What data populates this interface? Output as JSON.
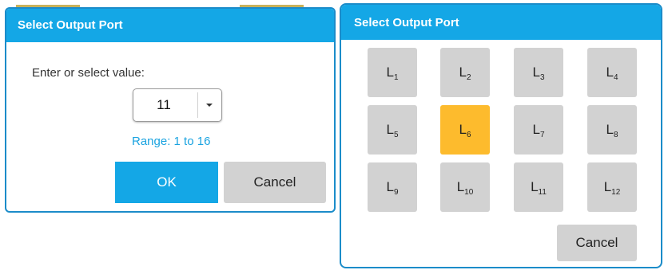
{
  "left_dialog": {
    "title": "Select Output Port",
    "prompt": "Enter or select value:",
    "combo_value": "11",
    "range": "Range: 1 to 16",
    "ok_label": "OK",
    "cancel_label": "Cancel"
  },
  "right_dialog": {
    "title": "Select Output Port",
    "ports": [
      {
        "label": "L",
        "sub": "1"
      },
      {
        "label": "L",
        "sub": "2"
      },
      {
        "label": "L",
        "sub": "3"
      },
      {
        "label": "L",
        "sub": "4"
      },
      {
        "label": "L",
        "sub": "5"
      },
      {
        "label": "L",
        "sub": "6",
        "selected": true
      },
      {
        "label": "L",
        "sub": "7"
      },
      {
        "label": "L",
        "sub": "8"
      },
      {
        "label": "L",
        "sub": "9"
      },
      {
        "label": "L",
        "sub": "10"
      },
      {
        "label": "L",
        "sub": "11"
      },
      {
        "label": "L",
        "sub": "12"
      }
    ],
    "cancel_label": "Cancel"
  },
  "colors": {
    "title_bar": "#14a7e6",
    "accent_blue": "#14a7e6",
    "selected": "#fdbb2d",
    "button_gray": "#d2d2d2"
  },
  "icons": {
    "dropdown": "chevron-down-icon"
  }
}
